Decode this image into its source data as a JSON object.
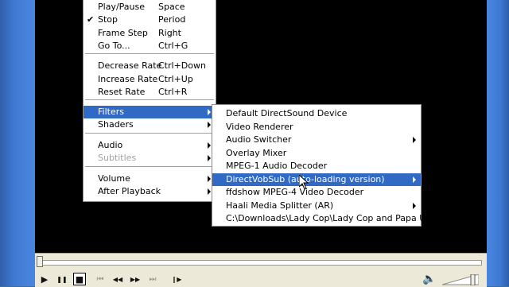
{
  "main_menu": {
    "items": [
      {
        "label": "Play/Pause",
        "shortcut": "Space",
        "checked": false,
        "submenu": false,
        "disabled": false,
        "selected": false
      },
      {
        "label": "Stop",
        "shortcut": "Period",
        "checked": true,
        "submenu": false,
        "disabled": false,
        "selected": false
      },
      {
        "label": "Frame Step",
        "shortcut": "Right",
        "checked": false,
        "submenu": false,
        "disabled": false,
        "selected": false
      },
      {
        "label": "Go To...",
        "shortcut": "Ctrl+G",
        "checked": false,
        "submenu": false,
        "disabled": false,
        "selected": false
      },
      {
        "label": "Decrease Rate",
        "shortcut": "Ctrl+Down",
        "checked": false,
        "submenu": false,
        "disabled": false,
        "selected": false
      },
      {
        "label": "Increase Rate",
        "shortcut": "Ctrl+Up",
        "checked": false,
        "submenu": false,
        "disabled": false,
        "selected": false
      },
      {
        "label": "Reset Rate",
        "shortcut": "Ctrl+R",
        "checked": false,
        "submenu": false,
        "disabled": false,
        "selected": false
      },
      {
        "label": "Filters",
        "shortcut": "",
        "checked": false,
        "submenu": true,
        "disabled": false,
        "selected": true
      },
      {
        "label": "Shaders",
        "shortcut": "",
        "checked": false,
        "submenu": true,
        "disabled": false,
        "selected": false
      },
      {
        "label": "Audio",
        "shortcut": "",
        "checked": false,
        "submenu": true,
        "disabled": false,
        "selected": false
      },
      {
        "label": "Subtitles",
        "shortcut": "",
        "checked": false,
        "submenu": true,
        "disabled": true,
        "selected": false
      },
      {
        "label": "Volume",
        "shortcut": "",
        "checked": false,
        "submenu": true,
        "disabled": false,
        "selected": false
      },
      {
        "label": "After Playback",
        "shortcut": "",
        "checked": false,
        "submenu": true,
        "disabled": false,
        "selected": false
      }
    ],
    "check_glyph": "✔"
  },
  "filters_submenu": {
    "items": [
      {
        "label": "Default DirectSound Device",
        "submenu": false,
        "selected": false
      },
      {
        "label": "Video Renderer",
        "submenu": false,
        "selected": false
      },
      {
        "label": "Audio Switcher",
        "submenu": true,
        "selected": false
      },
      {
        "label": "Overlay Mixer",
        "submenu": false,
        "selected": false
      },
      {
        "label": "MPEG-1 Audio Decoder",
        "submenu": false,
        "selected": false
      },
      {
        "label": "DirectVobSub (auto-loading version)",
        "submenu": true,
        "selected": true
      },
      {
        "label": "ffdshow MPEG-4 Video Decoder",
        "submenu": false,
        "selected": false
      },
      {
        "label": "Haali Media Splitter (AR)",
        "submenu": true,
        "selected": false
      },
      {
        "label": "C:\\Downloads\\Lady Cop\\Lady Cop and Papa Under...",
        "submenu": false,
        "selected": false
      }
    ]
  },
  "controls": {
    "play_icon": "▶",
    "pause_icon": "❚❚",
    "stop_icon": "■",
    "prev_icon": "⏮",
    "rewind_icon": "◀◀",
    "forward_icon": "▶▶",
    "next_icon": "⏭",
    "frame_step_icon": "❙▶",
    "volume_icon": "🔈"
  },
  "colors": {
    "selection": "#316ac5",
    "video_background": "#000000",
    "toolbar_background": "#ece9d8"
  }
}
